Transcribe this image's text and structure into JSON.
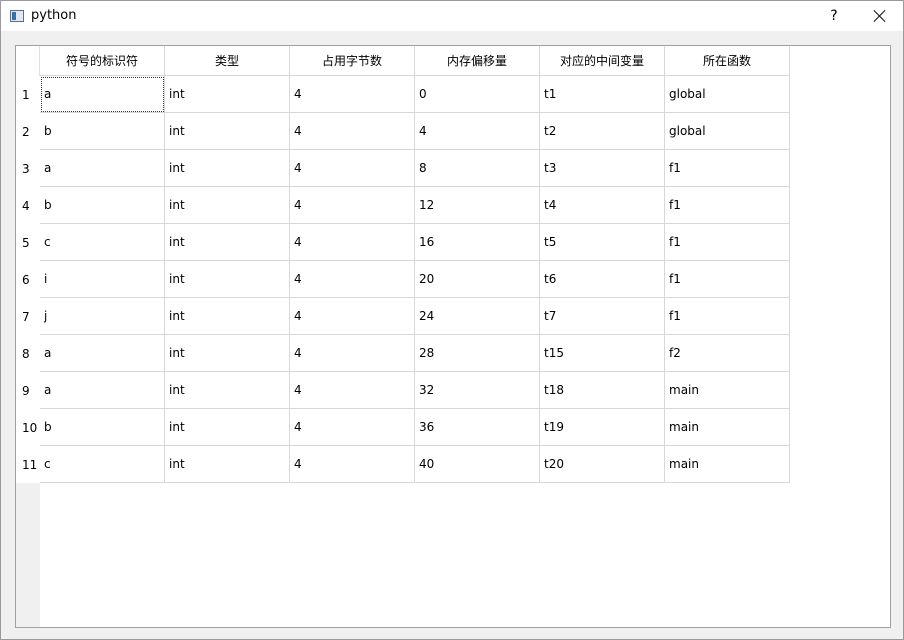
{
  "window": {
    "title": "python",
    "help_label": "?"
  },
  "table": {
    "headers": [
      "符号的标识符",
      "类型",
      "占用字节数",
      "内存偏移量",
      "对应的中间变量",
      "所在函数"
    ],
    "rows": [
      {
        "num": "1",
        "cells": [
          "a",
          "int",
          "4",
          "0",
          "t1",
          "global"
        ]
      },
      {
        "num": "2",
        "cells": [
          "b",
          "int",
          "4",
          "4",
          "t2",
          "global"
        ]
      },
      {
        "num": "3",
        "cells": [
          "a",
          "int",
          "4",
          "8",
          "t3",
          "f1"
        ]
      },
      {
        "num": "4",
        "cells": [
          "b",
          "int",
          "4",
          "12",
          "t4",
          "f1"
        ]
      },
      {
        "num": "5",
        "cells": [
          "c",
          "int",
          "4",
          "16",
          "t5",
          "f1"
        ]
      },
      {
        "num": "6",
        "cells": [
          "i",
          "int",
          "4",
          "20",
          "t6",
          "f1"
        ]
      },
      {
        "num": "7",
        "cells": [
          "j",
          "int",
          "4",
          "24",
          "t7",
          "f1"
        ]
      },
      {
        "num": "8",
        "cells": [
          "a",
          "int",
          "4",
          "28",
          "t15",
          "f2"
        ]
      },
      {
        "num": "9",
        "cells": [
          "a",
          "int",
          "4",
          "32",
          "t18",
          "main"
        ]
      },
      {
        "num": "10",
        "cells": [
          "b",
          "int",
          "4",
          "36",
          "t19",
          "main"
        ]
      },
      {
        "num": "11",
        "cells": [
          "c",
          "int",
          "4",
          "40",
          "t20",
          "main"
        ]
      }
    ]
  }
}
